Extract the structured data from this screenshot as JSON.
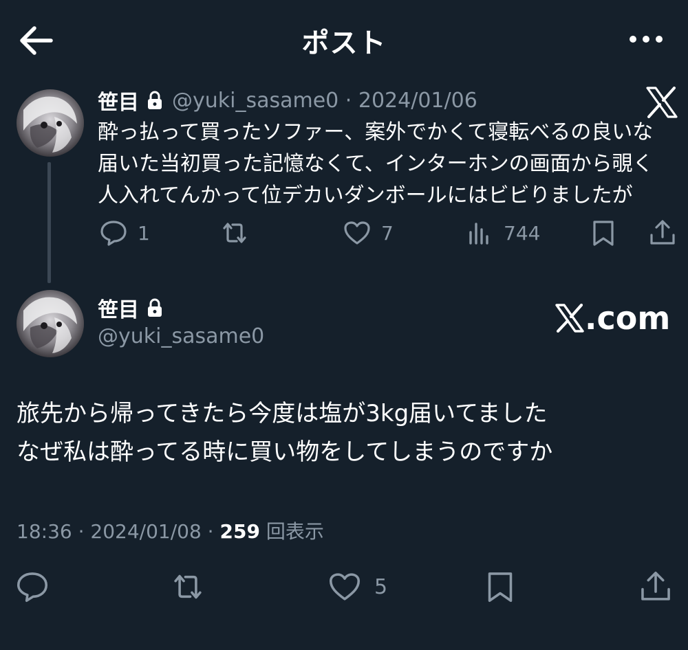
{
  "header": {
    "title": "ポスト",
    "back_icon": "arrow-left-icon",
    "more_icon": "more-horizontal-icon"
  },
  "colors": {
    "background": "#15202b",
    "text": "#ffffff",
    "secondary": "#8b98a5",
    "thread_line": "#3b4754"
  },
  "parent_post": {
    "name": "笹目",
    "handle": "@yuki_sasame0",
    "date": "2024/01/06",
    "meta": "@yuki_sasame0 · 2024/01/06",
    "text": "酔っ払って買ったソファー、案外でかくて寝転べるの良いな\n届いた当初買った記憶なくて、インターホンの画面から覗く\n人入れてんかって位デカいダンボールにはビビりましたが",
    "actions": {
      "replies": "1",
      "reposts": "",
      "likes": "7",
      "views": "744"
    }
  },
  "main_post": {
    "name": "笹目",
    "handle": "@yuki_sasame0",
    "watermark": ".com",
    "text": "旅先から帰ってきたら今度は塩が3kg届いてました\nなぜ私は酔ってる時に買い物をしてしまうのですか",
    "time": "18:36",
    "date": "2024/01/08",
    "time_date": "18:36 · 2024/01/08 · ",
    "views": "259",
    "views_label": "回表示",
    "actions": {
      "replies": "",
      "reposts": "",
      "likes": "5"
    }
  }
}
